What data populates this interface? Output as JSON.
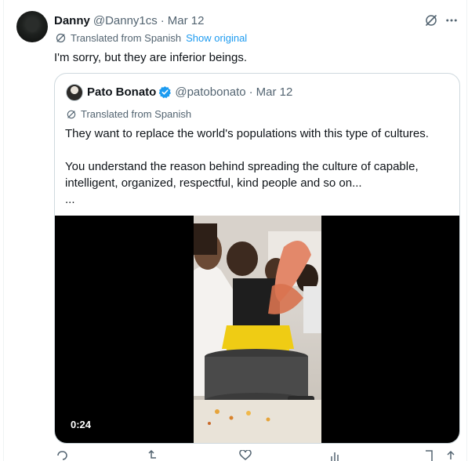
{
  "tweet": {
    "author_name": "Danny",
    "handle": "@Danny1cs",
    "separator": "·",
    "date": "Mar 12",
    "translated_label": "Translated from Spanish",
    "show_original": "Show original",
    "text": "I'm sorry, but they are inferior beings."
  },
  "quote": {
    "author_name": "Pato Bonato",
    "handle": "@patobonato",
    "separator": "·",
    "date": "Mar 12",
    "translated_label": "Translated from Spanish",
    "text_line1": "They want to replace the world's populations with this type of cultures.",
    "text_line2": "You understand the reason behind spreading the culture of capable,",
    "text_line3": "intelligent, organized, respectful, kind people and so on...",
    "text_line4": "...",
    "video_duration": "0:24"
  },
  "colors": {
    "link": "#1d9bf0",
    "verified": "#1d9bf0",
    "muted": "#536471",
    "border": "#cfd9de"
  },
  "icons": [
    "grok-icon",
    "more-icon",
    "translate-icon",
    "verified-badge-icon",
    "reply-icon",
    "repost-icon",
    "like-icon",
    "views-icon",
    "bookmark-icon",
    "share-icon"
  ]
}
